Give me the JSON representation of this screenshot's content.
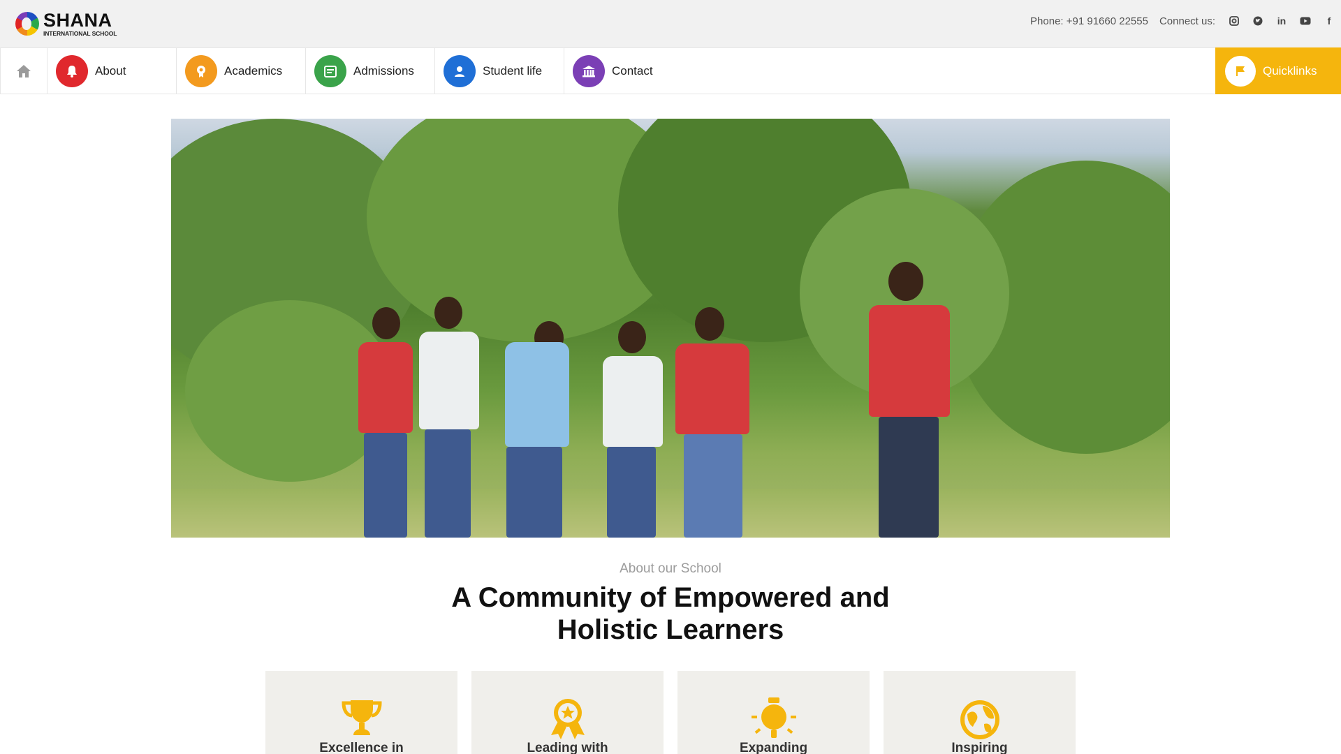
{
  "brand": {
    "name": "SHANA",
    "subtitle": "INTERNATIONAL SCHOOL"
  },
  "topbar": {
    "phone": "Phone: +91 91660 22555",
    "connect_label": "Connect us:",
    "social": [
      {
        "icon": "instagram-icon"
      },
      {
        "icon": "twitter-icon"
      },
      {
        "icon": "linkedin-icon",
        "glyph": "in"
      },
      {
        "icon": "youtube-icon"
      },
      {
        "icon": "facebook-icon",
        "glyph": "f"
      }
    ]
  },
  "nav": {
    "home_icon": "home-icon",
    "items": [
      {
        "label": "About",
        "color": "#e0282d",
        "icon": "bell-icon"
      },
      {
        "label": "Academics",
        "color": "#f39a1e",
        "icon": "award-icon"
      },
      {
        "label": "Admissions",
        "color": "#3aa34a",
        "icon": "calendar-icon"
      },
      {
        "label": "Student life",
        "color": "#1f6fd6",
        "icon": "person-icon"
      },
      {
        "label": "Contact",
        "color": "#7b3fb5",
        "icon": "building-icon"
      }
    ],
    "quicklinks": {
      "label": "Quicklinks",
      "color": "#f5b50d",
      "icon": "flag-icon"
    }
  },
  "about": {
    "eyebrow": "About our School",
    "title_line1": "A Community of Empowered and",
    "title_line2": "Holistic Learners"
  },
  "cards": [
    {
      "title": "Excellence in",
      "icon": "trophy-icon"
    },
    {
      "title": "Leading with",
      "icon": "medal-icon"
    },
    {
      "title": "Expanding",
      "icon": "bulb-icon"
    },
    {
      "title": "Inspiring",
      "icon": "globe-icon"
    }
  ],
  "colors": {
    "accent": "#f5b50d",
    "topbar_bg": "#f1f1f1",
    "card_bg": "#f0efeb"
  }
}
